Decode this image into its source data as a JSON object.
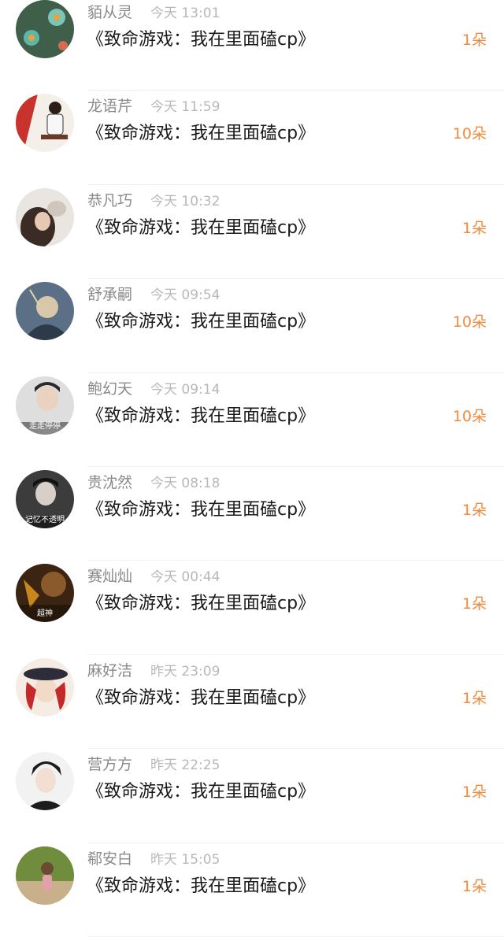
{
  "colors": {
    "accent": "#f08a3c",
    "name_text": "#8a8a8a",
    "time_text": "#b8b8b8",
    "title_text": "#1a1a1a"
  },
  "gifts": [
    {
      "name": "貊从灵",
      "time": "今天 13:01",
      "title": "《致命游戏：我在里面磕cp》",
      "count": "1朵",
      "avatar": {
        "kind": "flowers",
        "bg": "#3f5f4a",
        "accent": "#e7a23a"
      }
    },
    {
      "name": "龙语芹",
      "time": "今天 11:59",
      "title": "《致命游戏：我在里面磕cp》",
      "count": "10朵",
      "avatar": {
        "kind": "figure-red",
        "bg": "#f4efe9",
        "accent": "#c8332d"
      }
    },
    {
      "name": "恭凡巧",
      "time": "今天 10:32",
      "title": "《致命游戏：我在里面磕cp》",
      "count": "1朵",
      "avatar": {
        "kind": "girl-cat",
        "bg": "#e9e5e0",
        "accent": "#3a2b24"
      }
    },
    {
      "name": "舒承嗣",
      "time": "今天 09:54",
      "title": "《致命游戏：我在里面磕cp》",
      "count": "10朵",
      "avatar": {
        "kind": "illustration",
        "bg": "#5b6f86",
        "accent": "#d8c7a8"
      }
    },
    {
      "name": "鲍幻天",
      "time": "今天 09:14",
      "title": "《致命游戏：我在里面磕cp》",
      "count": "10朵",
      "avatar": {
        "kind": "boy-light",
        "bg": "#dedede",
        "accent": "#2a2a2a",
        "caption": "走走停停"
      }
    },
    {
      "name": "贵沈然",
      "time": "今天 08:18",
      "title": "《致命游戏：我在里面磕cp》",
      "count": "1朵",
      "avatar": {
        "kind": "man-dark",
        "bg": "#3c3c3c",
        "accent": "#e8e8e8",
        "caption": "记忆不透明"
      }
    },
    {
      "name": "赛灿灿",
      "time": "今天 00:44",
      "title": "《致命游戏：我在里面磕cp》",
      "count": "1朵",
      "avatar": {
        "kind": "game",
        "bg": "#3b2412",
        "accent": "#f2b233",
        "caption": "超神"
      }
    },
    {
      "name": "麻好洁",
      "time": "昨天 23:09",
      "title": "《致命游戏：我在里面磕cp》",
      "count": "1朵",
      "avatar": {
        "kind": "girl-hat",
        "bg": "#f5ece4",
        "accent": "#c42a2a"
      }
    },
    {
      "name": "营方方",
      "time": "昨天 22:25",
      "title": "《致命游戏：我在里面磕cp》",
      "count": "1朵",
      "avatar": {
        "kind": "boy-dark-hair",
        "bg": "#f2f2f2",
        "accent": "#1c1c1c"
      }
    },
    {
      "name": "郗安白",
      "time": "昨天 15:05",
      "title": "《致命游戏：我在里面磕cp》",
      "count": "1朵",
      "avatar": {
        "kind": "child-outdoor",
        "bg": "#6f8d3d",
        "accent": "#c8b08a"
      }
    }
  ]
}
